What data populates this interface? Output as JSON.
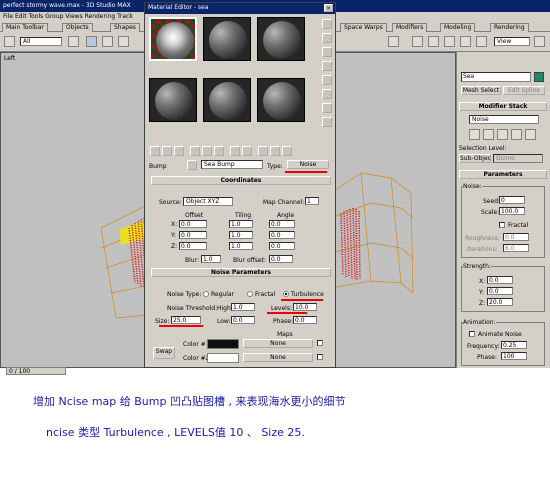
{
  "max": {
    "title": "perfect stormy wave.max - 3D Studio MAX",
    "menu": "File  Edit  Tools  Group  Views  Rendering  Track",
    "tabs": {
      "main_toolbar": "Main Toolbar",
      "objects": "Objects",
      "shapes": "Shapes",
      "space_warps": "Space Warps",
      "modifiers": "Modifiers",
      "modeling": "Modeling",
      "rendering": "Rendering"
    },
    "toolbar": {
      "filter": "All",
      "view": "View"
    },
    "viewport": {
      "label": "Left",
      "status": "0 / 100"
    }
  },
  "material_editor": {
    "title": "Material Editor - sea",
    "bump_label": "Bump",
    "material_name": "Sea Bump",
    "type_label": "Type:",
    "type_value": "Noise",
    "coordinates": {
      "header": "Coordinates",
      "source_label": "Source:",
      "source_value": "Object XYZ",
      "map_channel_label": "Map Channel:",
      "map_channel_value": "1",
      "col_offset": "Offset",
      "col_tiling": "Tiling",
      "col_angle": "Angle",
      "x": "X:",
      "y": "Y:",
      "z": "Z:",
      "offset": [
        "0.0",
        "0.0",
        "0.0"
      ],
      "tiling": [
        "1.0",
        "1.0",
        "1.0"
      ],
      "angle": [
        "0.0",
        "0.0",
        "0.0"
      ],
      "blur_label": "Blur:",
      "blur_value": "1.0",
      "blur_offset_label": "Blur offset:",
      "blur_offset_value": "0.0"
    },
    "noise": {
      "header": "Noise Parameters",
      "type_label": "Noise Type:",
      "regular": "Regular",
      "fractal": "Fractal",
      "turbulence": "Turbulence",
      "threshold_label": "Noise Threshold:",
      "high_label": "High:",
      "high_value": "1.0",
      "levels_label": "Levels:",
      "levels_value": "10.0",
      "low_label": "Low:",
      "low_value": "0.0",
      "phase_label": "Phase:",
      "phase_value": "0.0",
      "size_label": "Size:",
      "size_value": "25.0",
      "maps_label": "Maps",
      "swap": "Swap",
      "color1_label": "Color #1",
      "color1_map": "None",
      "color2_label": "Color #2",
      "color2_map": "None"
    },
    "colors": {
      "color1": "#101010",
      "color2": "#ffffff"
    }
  },
  "command_panel": {
    "object_name": "Sea",
    "mesh_select": "Mesh Select",
    "edit_spline": "Edit Spline",
    "modifier_stack": "Modifier Stack",
    "modifier_value": "Noise",
    "selection_level": "Selection Level:",
    "sub_object": "Sub-Object",
    "gizmo": "Gizmo",
    "parameters": "Parameters",
    "noise_group": "Noise:",
    "seed_label": "Seed:",
    "seed_value": "0",
    "scale_label": "Scale:",
    "scale_value": "100.0",
    "fractal": "Fractal",
    "roughness_label": "Roughness:",
    "roughness_value": "0.0",
    "iterations_label": "Iterations:",
    "iterations_value": "6.0",
    "strength_group": "Strength:",
    "x_label": "X:",
    "x_value": "0.0",
    "y_label": "Y:",
    "y_value": "0.0",
    "z_label": "Z:",
    "z_value": "20.0",
    "animation_group": "Animation:",
    "animate_noise": "Animate Noise",
    "frequency_label": "Frequency:",
    "frequency_value": "0.25",
    "phase_label": "Phase:",
    "phase_value": "100"
  },
  "caption": {
    "line1": "增加 Ncise map 给 Bump 凹凸贴图槽 , 来表现海水更小的细节",
    "line2": "ncise 类型 Turbulence , LEVELS值 10 、 Size  25."
  },
  "accent": {
    "red": "#e00000",
    "title_blue": "#0a246a",
    "wave_red": "#d81818",
    "wire_orange": "#d08a18"
  }
}
